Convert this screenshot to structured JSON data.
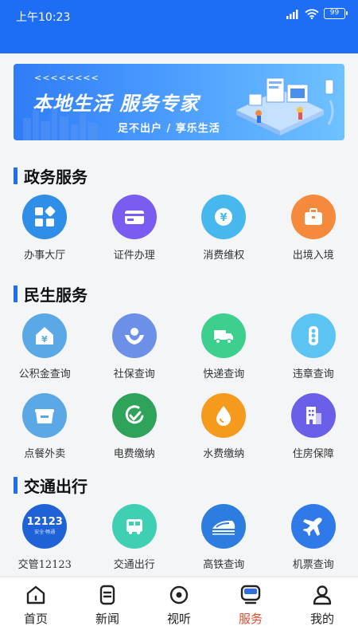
{
  "status": {
    "time": "上午10:23",
    "battery": "99"
  },
  "banner": {
    "arrows": "<<<<<<<<",
    "title": "本地生活 服务专家",
    "subtitle": "足不出户 / 享乐生活"
  },
  "sections": [
    {
      "title": "政务服务",
      "items": [
        {
          "label": "办事大厅",
          "icon": "hall-icon",
          "color": "#2f8fe8"
        },
        {
          "label": "证件办理",
          "icon": "card-icon",
          "color": "#7b5cf0"
        },
        {
          "label": "消费维权",
          "icon": "yuan-icon",
          "color": "#47b8ee"
        },
        {
          "label": "出境入境",
          "icon": "suitcase-icon",
          "color": "#f58a3c"
        }
      ]
    },
    {
      "title": "民生服务",
      "items": [
        {
          "label": "公积金查询",
          "icon": "house-yuan-icon",
          "color": "#5aa9e6"
        },
        {
          "label": "社保查询",
          "icon": "hands-icon",
          "color": "#6c8fe8"
        },
        {
          "label": "快递查询",
          "icon": "truck-icon",
          "color": "#3ccf8e"
        },
        {
          "label": "违章查询",
          "icon": "traffic-light-icon",
          "color": "#5bc4f2"
        },
        {
          "label": "点餐外卖",
          "icon": "takeout-box-icon",
          "color": "#5aa9e6"
        },
        {
          "label": "电费缴纳",
          "icon": "electric-icon",
          "color": "#2fa35a"
        },
        {
          "label": "水费缴纳",
          "icon": "water-drop-icon",
          "color": "#f59a1c"
        },
        {
          "label": "住房保障",
          "icon": "building-icon",
          "color": "#6a5fe8"
        }
      ]
    },
    {
      "title": "交通出行",
      "items": [
        {
          "label": "交管12123",
          "icon": "12123-icon",
          "color": "#1f62d6",
          "badge": "12123",
          "badge_sub": "安全·畅通"
        },
        {
          "label": "交通出行",
          "icon": "bus-icon",
          "color": "#3fd0b4"
        },
        {
          "label": "高铁查询",
          "icon": "train-icon",
          "color": "#2d7de0"
        },
        {
          "label": "机票查询",
          "icon": "plane-icon",
          "color": "#2f7ae8"
        }
      ]
    }
  ],
  "tabs": [
    {
      "label": "首页",
      "icon": "home-icon",
      "active": false
    },
    {
      "label": "新闻",
      "icon": "news-icon",
      "active": false
    },
    {
      "label": "视听",
      "icon": "media-icon",
      "active": false
    },
    {
      "label": "服务",
      "icon": "service-icon",
      "active": true
    },
    {
      "label": "我的",
      "icon": "profile-icon",
      "active": false
    }
  ]
}
